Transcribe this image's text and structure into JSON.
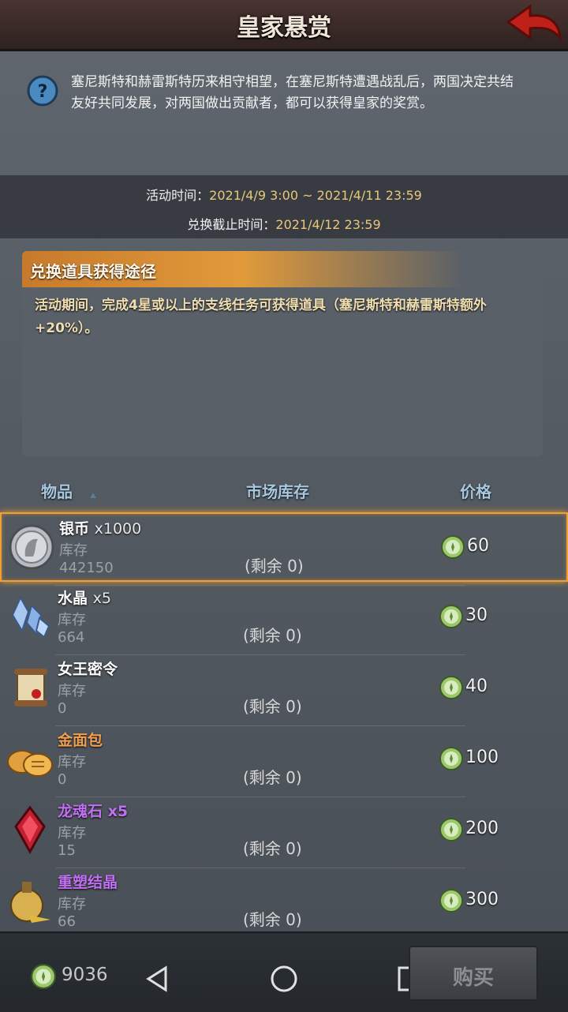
{
  "header": {
    "title": "皇家悬赏"
  },
  "description": "塞尼斯特和赫雷斯特历来相守相望，在塞尼斯特遭遇战乱后，两国决定共结友好共同发展，对两国做出贡献者，都可以获得皇家的奖赏。",
  "activity": {
    "time_label": "活动时间：",
    "time_value": "2021/4/9 3:00 ~ 2021/4/11 23:59",
    "deadline_label": "兑换截止时间：",
    "deadline_value": "2021/4/12 23:59"
  },
  "obtain": {
    "title": "兑换道具获得途径",
    "text": "活动期间，完成4星或以上的支线任务可获得道具（塞尼斯特和赫雷斯特额外+20%）。"
  },
  "columns": {
    "item": "物品",
    "stock": "市场库存",
    "price": "价格"
  },
  "colors": {
    "accent": "#f0a030",
    "name_orange": "#f0a050",
    "name_purple": "#c070f0",
    "time_value": "#e8c878"
  },
  "items": [
    {
      "name": "银币",
      "qty": "x1000",
      "stock_label": "库存",
      "stock": "442150",
      "remain": "(剩余 0)",
      "price": "60",
      "icon": "silver-coin-icon",
      "selected": true
    },
    {
      "name": "水晶",
      "qty": "x5",
      "stock_label": "库存",
      "stock": "664",
      "remain": "(剩余 0)",
      "price": "30",
      "icon": "crystal-icon"
    },
    {
      "name": "女王密令",
      "qty": "",
      "stock_label": "库存",
      "stock": "0",
      "remain": "(剩余 0)",
      "price": "40",
      "icon": "scroll-icon"
    },
    {
      "name": "金面包",
      "qty": "",
      "stock_label": "库存",
      "stock": "0",
      "remain": "(剩余 0)",
      "price": "100",
      "icon": "bread-icon"
    },
    {
      "name": "龙魂石",
      "qty": "x5",
      "stock_label": "库存",
      "stock": "15",
      "remain": "(剩余 0)",
      "price": "200",
      "icon": "dragon-stone-icon"
    },
    {
      "name": "重塑结晶",
      "qty": "",
      "stock_label": "库存",
      "stock": "66",
      "remain": "(剩余 0)",
      "price": "300",
      "icon": "potion-icon"
    }
  ],
  "footer": {
    "balance": "9036",
    "buy_label": "购买"
  }
}
